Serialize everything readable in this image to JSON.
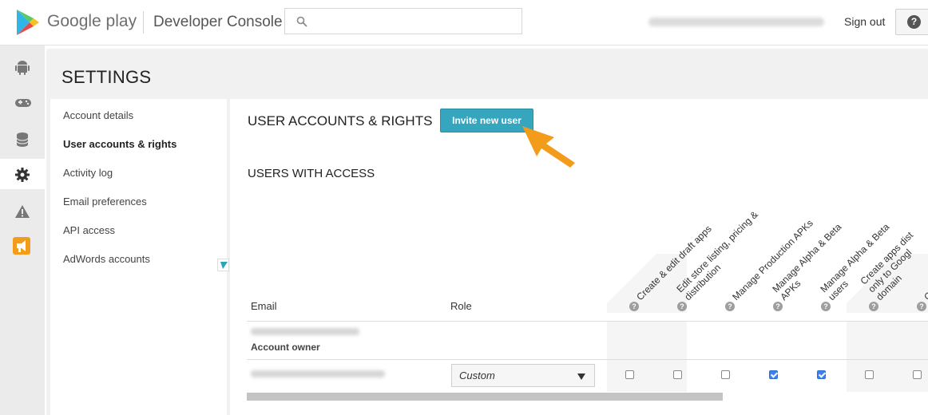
{
  "header": {
    "brand": "Google play",
    "product": "Developer Console",
    "search_placeholder": "",
    "sign_out": "Sign out",
    "help_glyph": "?"
  },
  "rail": {
    "icons": [
      "android-icon",
      "gamepad-icon",
      "database-icon",
      "gear-icon",
      "warning-icon",
      "megaphone-icon"
    ],
    "active": "gear-icon"
  },
  "page": {
    "title": "SETTINGS"
  },
  "subnav": {
    "items": [
      {
        "label": "Account details"
      },
      {
        "label": "User accounts & rights"
      },
      {
        "label": "Activity log"
      },
      {
        "label": "Email preferences"
      },
      {
        "label": "API access"
      },
      {
        "label": "AdWords accounts"
      }
    ],
    "active_index": 1
  },
  "main": {
    "section_title": "USER ACCOUNTS & RIGHTS",
    "invite_button": "Invite new user",
    "users_title": "USERS WITH ACCESS",
    "table": {
      "col_email": "Email",
      "col_role": "Role",
      "permissions": [
        {
          "lines": [
            "Create & edit draft apps"
          ]
        },
        {
          "lines": [
            "Edit store listing, pricing &",
            "distribution"
          ]
        },
        {
          "lines": [
            "Manage Production APKs"
          ]
        },
        {
          "lines": [
            "Manage Alpha & Beta",
            "APKs"
          ]
        },
        {
          "lines": [
            "Manage Alpha & Beta",
            "users"
          ]
        },
        {
          "lines": [
            "Create apps dist",
            "only to Googl",
            "domain"
          ]
        },
        {
          "lines": [
            "C"
          ]
        }
      ],
      "help_glyph": "?",
      "rows": [
        {
          "owner_label": "Account owner"
        },
        {
          "role": "Custom",
          "permissions": [
            false,
            false,
            false,
            true,
            true,
            false,
            false
          ]
        }
      ]
    },
    "colors": {
      "invite_bg": "#36a6bf",
      "arrow": "#f39b1a",
      "checkbox_checked": "#3b82f0"
    }
  }
}
